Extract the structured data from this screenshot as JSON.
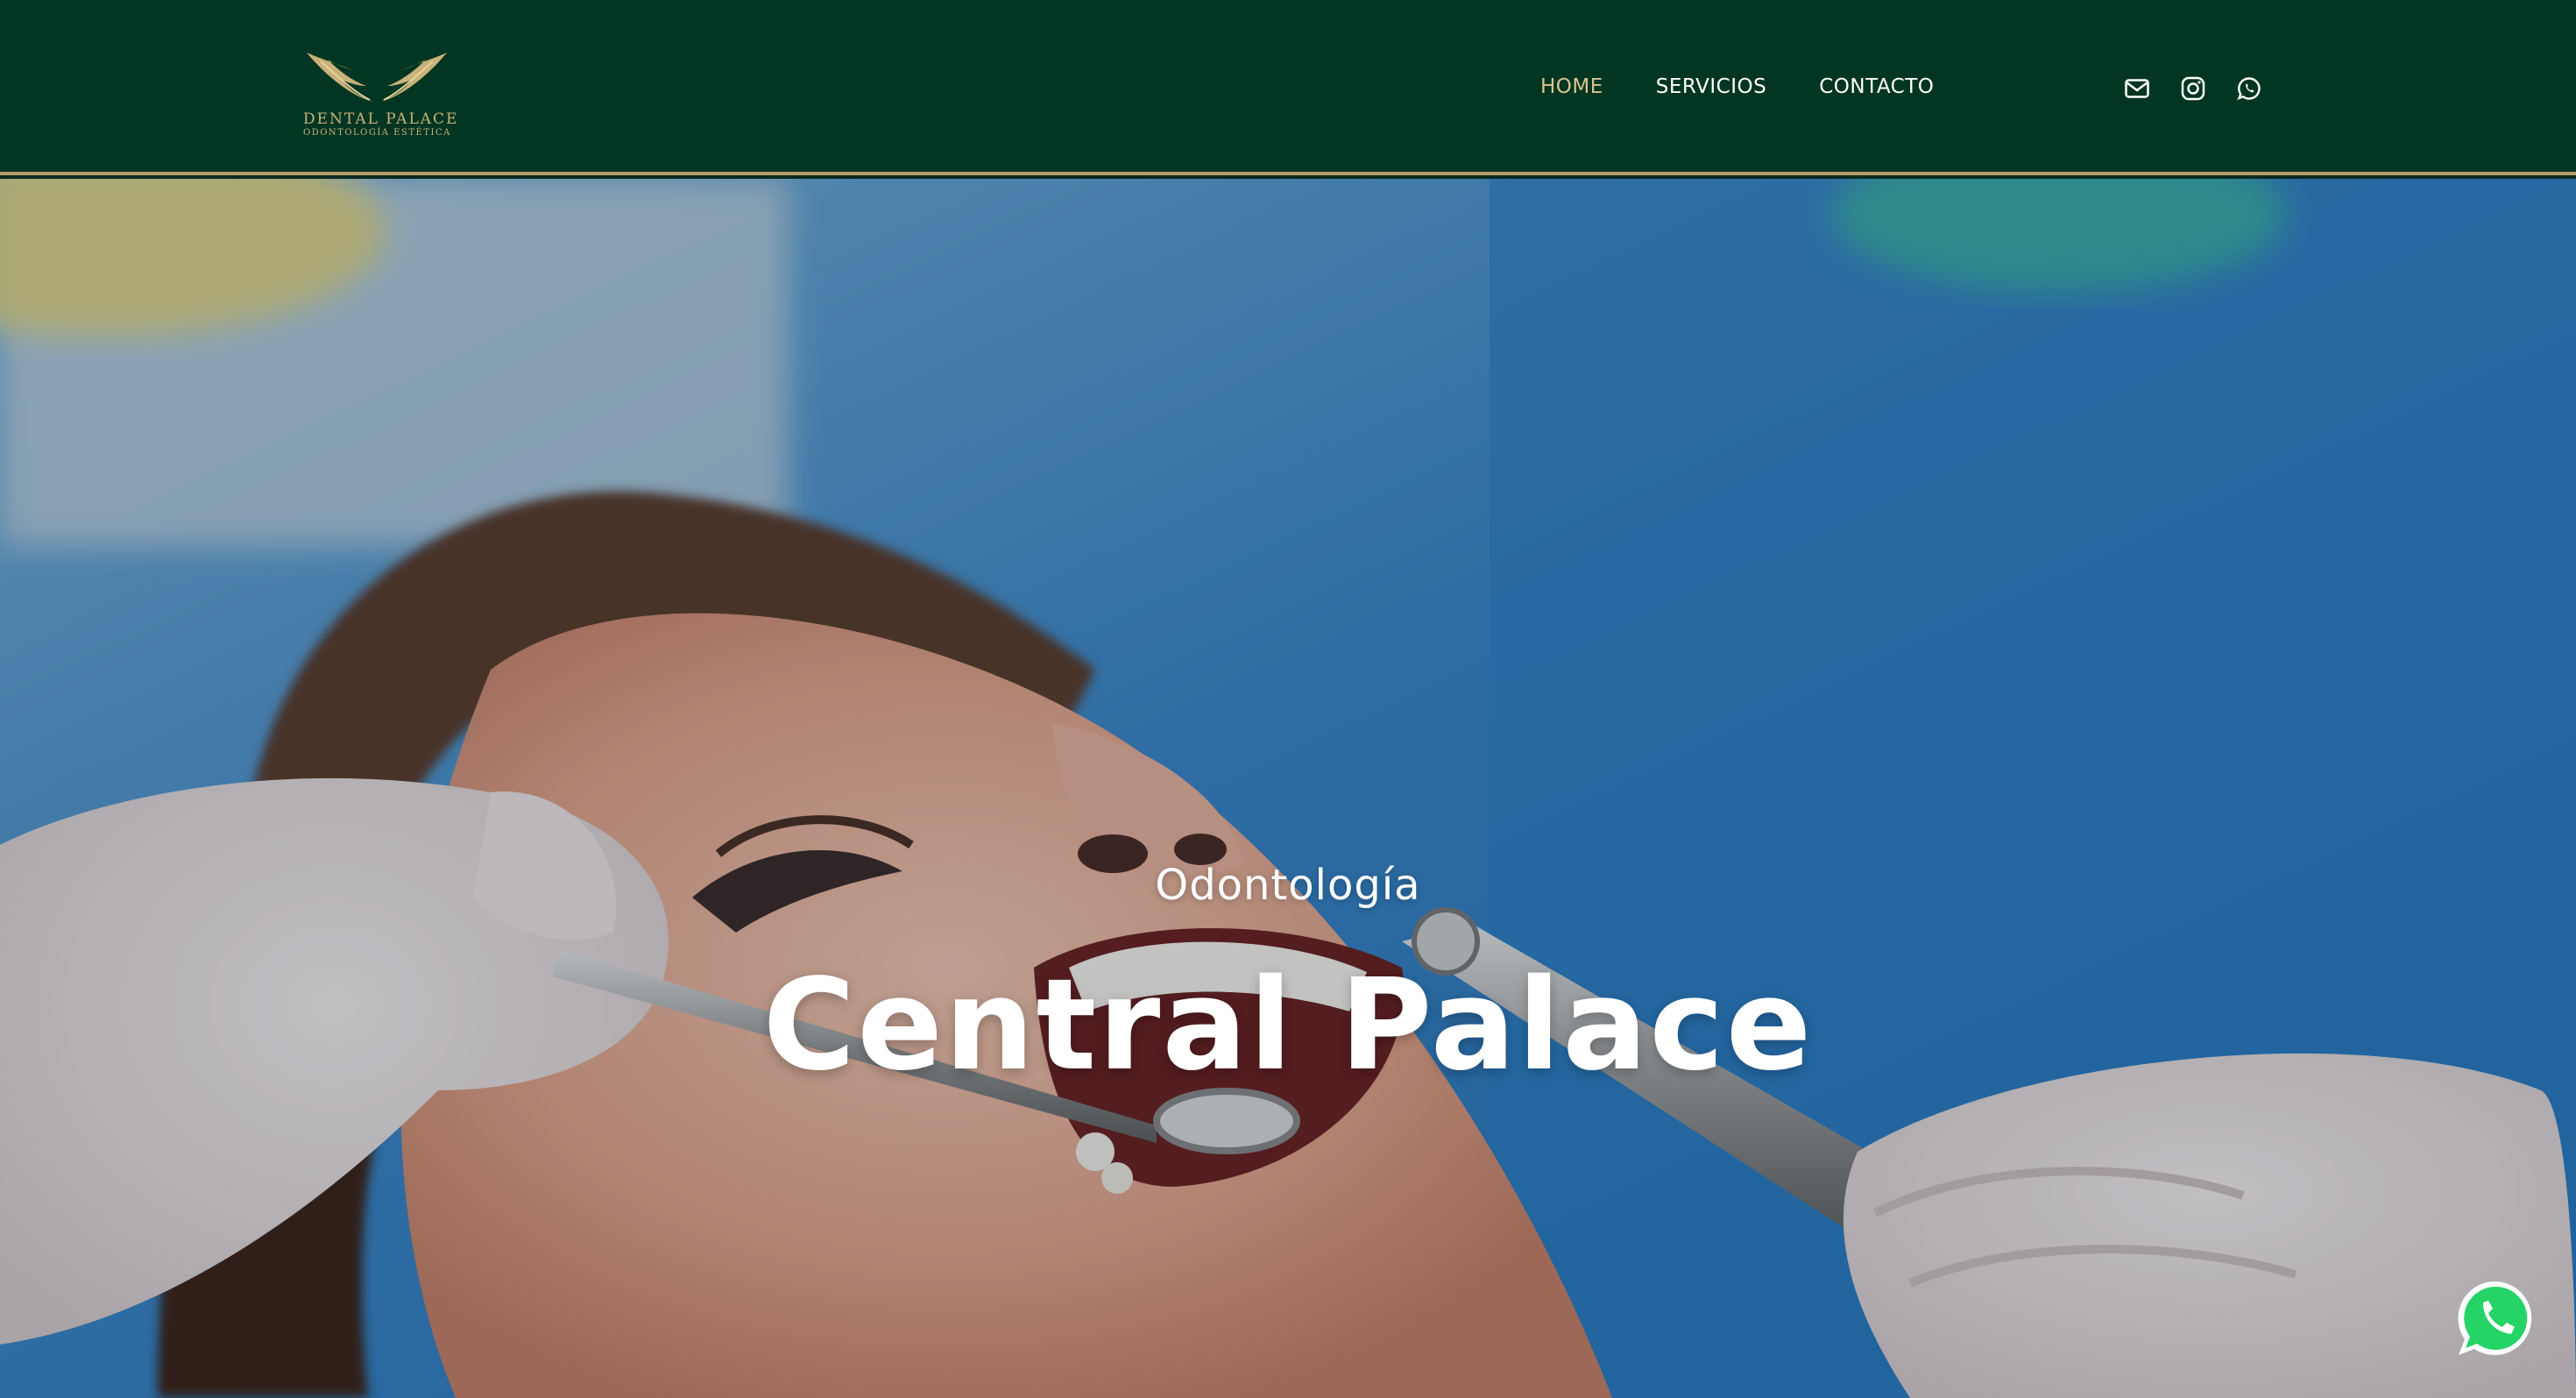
{
  "brand": {
    "name": "DENTAL PALACE",
    "tagline": "ODONTOLOGÍA ESTÉTICA",
    "logo_icon": "wings-logo-icon",
    "gold": "#c9b27a"
  },
  "header": {
    "background": "#023622",
    "accent": "#b49d6a"
  },
  "nav": {
    "items": [
      {
        "label": "HOME",
        "active": true
      },
      {
        "label": "SERVICIOS",
        "active": false
      },
      {
        "label": "CONTACTO",
        "active": false
      }
    ]
  },
  "social": {
    "icons": [
      "envelope-icon",
      "instagram-icon",
      "whatsapp-icon"
    ]
  },
  "hero": {
    "kicker": "Odontología",
    "title": "Central Palace",
    "image_subject": "dental-treatment-photo"
  },
  "floating": {
    "whatsapp_icon": "whatsapp-float-icon",
    "color": "#25d366"
  }
}
